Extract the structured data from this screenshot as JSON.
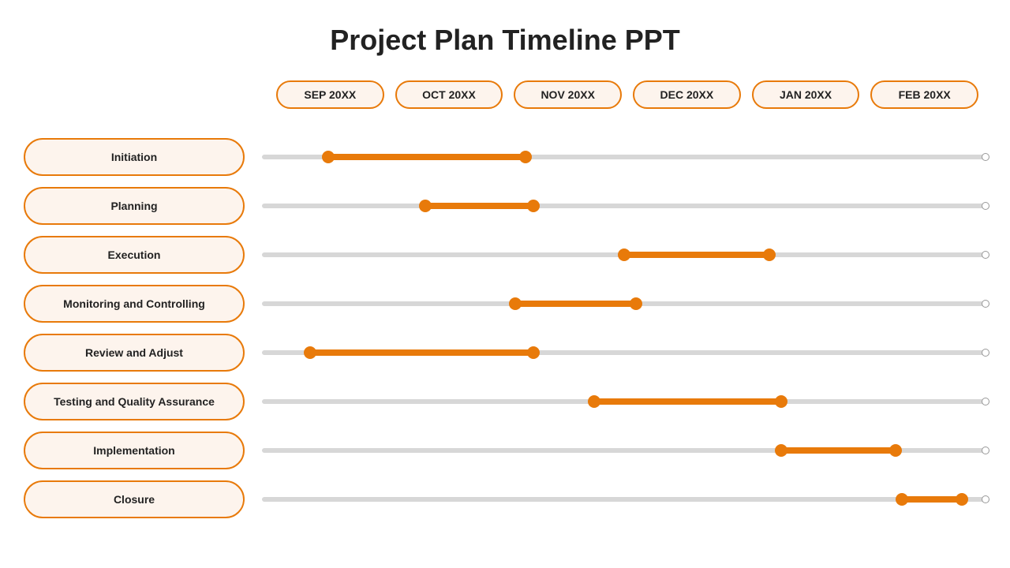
{
  "title": "Project Plan Timeline PPT",
  "chart_data": {
    "type": "bar",
    "title": "Project Plan Timeline PPT",
    "categories": [
      "SEP 20XX",
      "OCT 20XX",
      "NOV 20XX",
      "DEC 20XX",
      "JAN 20XX",
      "FEB 20XX"
    ],
    "xlabel": "",
    "ylabel": "",
    "xlim": [
      0,
      6
    ],
    "series": [
      {
        "name": "Initiation",
        "start": 0.55,
        "end": 2.18
      },
      {
        "name": "Planning",
        "start": 1.35,
        "end": 2.25
      },
      {
        "name": "Execution",
        "start": 3.0,
        "end": 4.2
      },
      {
        "name": "Monitoring and Controlling",
        "start": 2.1,
        "end": 3.1
      },
      {
        "name": "Review and Adjust",
        "start": 0.4,
        "end": 2.25
      },
      {
        "name": "Testing and Quality Assurance",
        "start": 2.75,
        "end": 4.3
      },
      {
        "name": "Implementation",
        "start": 4.3,
        "end": 5.25
      },
      {
        "name": "Closure",
        "start": 5.3,
        "end": 5.8
      }
    ]
  },
  "colors": {
    "accent": "#e87a0a",
    "pill_bg": "#fdf4ed",
    "track": "#d7d7d7"
  }
}
